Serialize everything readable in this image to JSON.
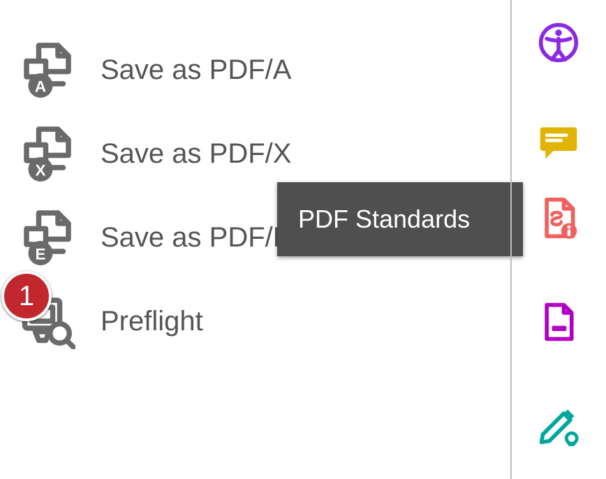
{
  "tools": [
    {
      "label": "Save as PDF/A",
      "glyph": "A"
    },
    {
      "label": "Save as PDF/X",
      "glyph": "X"
    },
    {
      "label": "Save as PDF/E",
      "glyph": "E"
    },
    {
      "label": "Preflight",
      "glyph": ""
    }
  ],
  "tooltip": {
    "label": "PDF Standards"
  },
  "badge": {
    "number": "1"
  },
  "rail": {
    "accessibility": "accessibility",
    "comment": "comment",
    "pdf_standards": "pdf-standards",
    "delete_pages": "delete-pages",
    "sign": "fill-and-sign"
  },
  "colors": {
    "icon_gray": "#6a6a6a",
    "accessibility": "#8a2be2",
    "comment_fill": "#e0b400",
    "standards": "#f0615e",
    "delete": "#b100c4",
    "sign": "#00a79d"
  }
}
